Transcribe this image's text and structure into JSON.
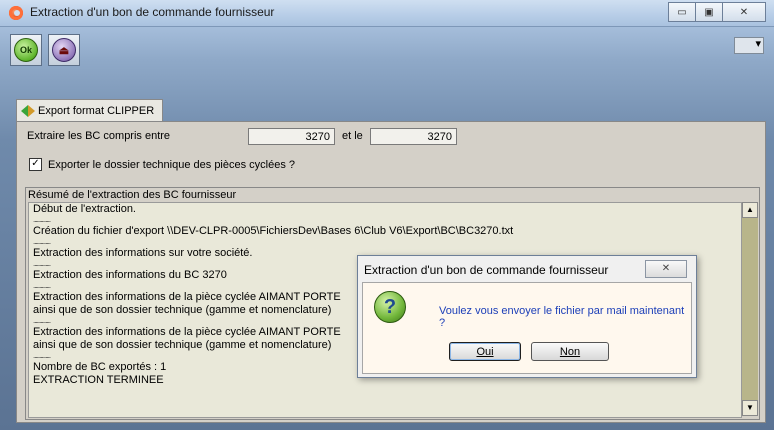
{
  "window": {
    "title": "Extraction d'un bon de commande fournisseur",
    "buttons": {
      "minimize": "▭",
      "maximize": "▣",
      "close": "✕"
    }
  },
  "toolbar": {
    "ok_label": "Ok",
    "exit_icon": "door-exit-icon"
  },
  "tab": {
    "label": "Export format CLIPPER"
  },
  "form": {
    "range_label": "Extraire les BC compris entre",
    "from_value": "3270",
    "and_label": "et le",
    "to_value": "3270",
    "checkbox_label": "Exporter le dossier technique des pièces cyclées ?",
    "checkbox_checked": "✓"
  },
  "summary": {
    "label": "Résumé de l'extraction des BC fournisseur",
    "separator": "..............",
    "lines": [
      "Début de l'extraction.",
      "Création du fichier d'export \\\\DEV-CLPR-0005\\FichiersDev\\Bases 6\\Club V6\\Export\\BC\\BC3270.txt",
      "Extraction des informations sur votre société.",
      "Extraction des informations du BC 3270",
      "Extraction des informations de la pièce cyclée AIMANT PORTE",
      "ainsi que de son dossier technique (gamme et nomenclature)",
      "Extraction des informations de la pièce cyclée AIMANT PORTE",
      "ainsi que de son dossier technique (gamme et nomenclature)",
      "Nombre de BC exportés : 1",
      "EXTRACTION TERMINEE"
    ],
    "scroll_up": "▲",
    "scroll_down": "▼"
  },
  "dialog": {
    "title": "Extraction d'un bon de commande fournisseur",
    "close": "✕",
    "icon": "question-icon",
    "icon_glyph": "?",
    "message": "Voulez vous envoyer le fichier par mail maintenant ?",
    "yes_label": "Oui",
    "no_label": "Non"
  }
}
